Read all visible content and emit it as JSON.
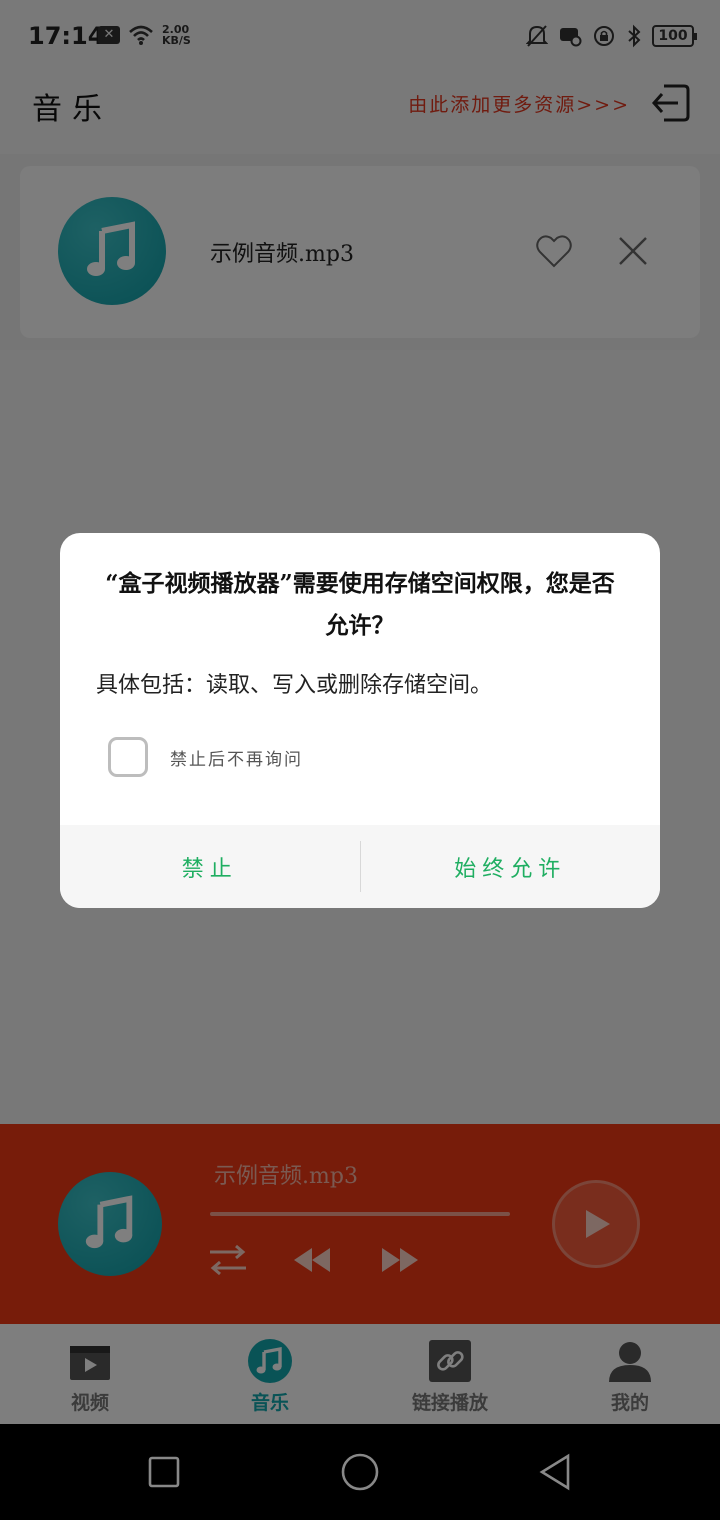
{
  "status_bar": {
    "time": "17:14",
    "net_speed_value": "2.00",
    "net_speed_unit": "KB/S",
    "battery": "100"
  },
  "header": {
    "title": "音乐",
    "add_source_link": "由此添加更多资源>>>"
  },
  "track_list": [
    {
      "name": "示例音频.mp3"
    }
  ],
  "player": {
    "title": "示例音频.mp3",
    "progress": 0
  },
  "bottom_nav": [
    {
      "label": "视频",
      "icon": "video-icon",
      "active": false
    },
    {
      "label": "音乐",
      "icon": "music-icon",
      "active": true
    },
    {
      "label": "链接播放",
      "icon": "link-icon",
      "active": false
    },
    {
      "label": "我的",
      "icon": "user-icon",
      "active": false
    }
  ],
  "dialog": {
    "title": "“盒子视频播放器”需要使用存储空间权限，您是否允许？",
    "description": "具体包括：读取、写入或删除存储空间。",
    "dont_ask_label": "禁止后不再询问",
    "deny_label": "禁止",
    "allow_label": "始终允许"
  },
  "colors": {
    "accent_teal": "#12a6ad",
    "player_red": "#ef3814",
    "link_red": "#e0361f",
    "dialog_green": "#1fae61"
  }
}
